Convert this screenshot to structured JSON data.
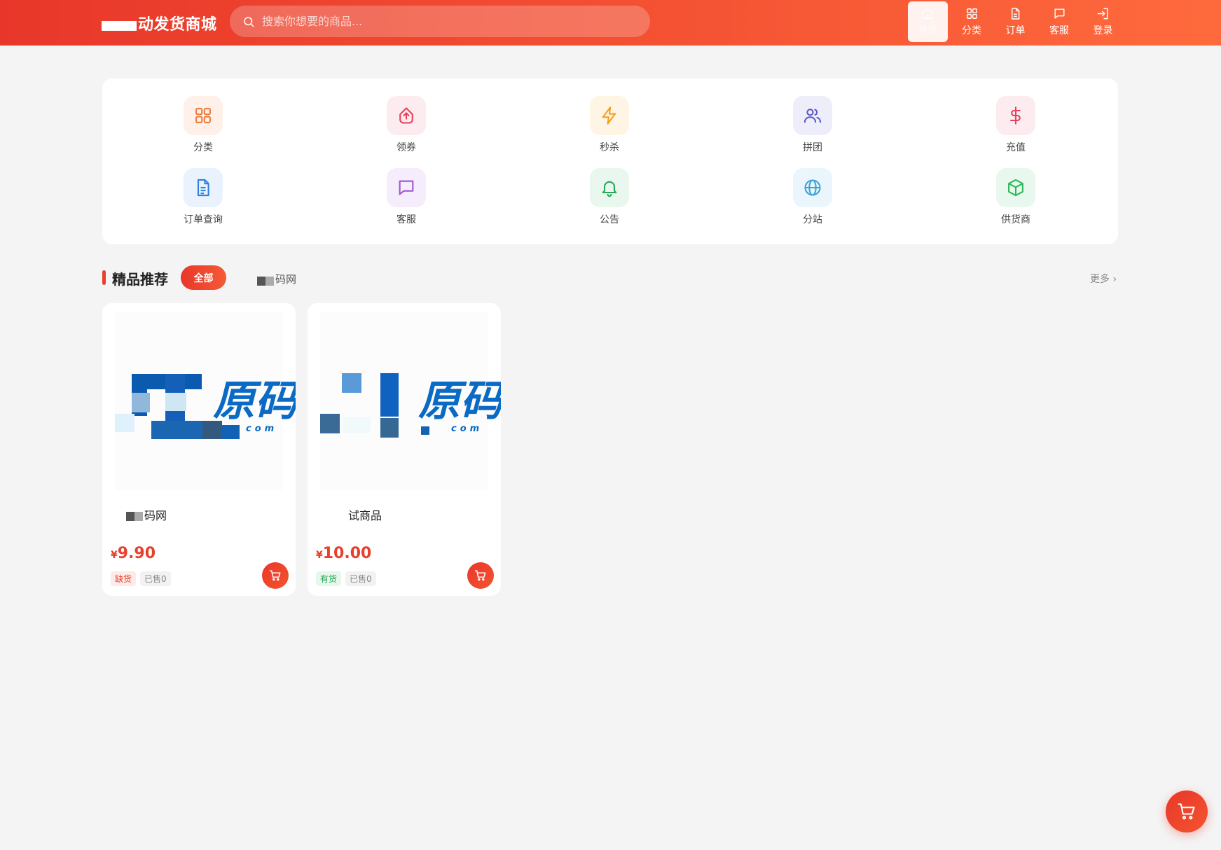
{
  "header": {
    "logo_text": "动发货商城",
    "search_placeholder": "搜索你想要的商品...",
    "nav": [
      {
        "label": "首页",
        "icon": "home-icon",
        "active": true
      },
      {
        "label": "分类",
        "icon": "grid-icon"
      },
      {
        "label": "订单",
        "icon": "file-icon"
      },
      {
        "label": "客服",
        "icon": "chat-icon"
      },
      {
        "label": "登录",
        "icon": "login-icon"
      }
    ]
  },
  "quick_menu": [
    {
      "label": "分类",
      "icon": "grid-icon",
      "color": "#f07a3c",
      "bg": "#fff1e9"
    },
    {
      "label": "领券",
      "icon": "upload-icon",
      "color": "#e8405a",
      "bg": "#fdecef"
    },
    {
      "label": "秒杀",
      "icon": "lightning-icon",
      "color": "#f0a020",
      "bg": "#fff5e5"
    },
    {
      "label": "拼团",
      "icon": "users-icon",
      "color": "#5a58c8",
      "bg": "#eeeefb"
    },
    {
      "label": "充值",
      "icon": "dollar-icon",
      "color": "#e8405a",
      "bg": "#fdecef"
    },
    {
      "label": "订单查询",
      "icon": "document-icon",
      "color": "#2f7fe0",
      "bg": "#e9f2fd"
    },
    {
      "label": "客服",
      "icon": "chat-icon",
      "color": "#a055d8",
      "bg": "#f5ecfc"
    },
    {
      "label": "公告",
      "icon": "bell-icon",
      "color": "#28a85a",
      "bg": "#e9f7ef"
    },
    {
      "label": "分站",
      "icon": "globe-icon",
      "color": "#3aa3d8",
      "bg": "#eaf6fc"
    },
    {
      "label": "供货商",
      "icon": "box-icon",
      "color": "#2eb85c",
      "bg": "#e9f8ee"
    }
  ],
  "section": {
    "title": "精品推荐",
    "tab_all": "全部",
    "tab_other": "码网",
    "more": "更多 ›"
  },
  "products": [
    {
      "name": "码网",
      "currency": "¥",
      "price": "9.90",
      "stock": "缺货",
      "in_stock": false,
      "sold": "已售0"
    },
    {
      "name": "试商品",
      "currency": "¥",
      "price": "10.00",
      "stock": "有货",
      "in_stock": true,
      "sold": "已售0"
    }
  ]
}
